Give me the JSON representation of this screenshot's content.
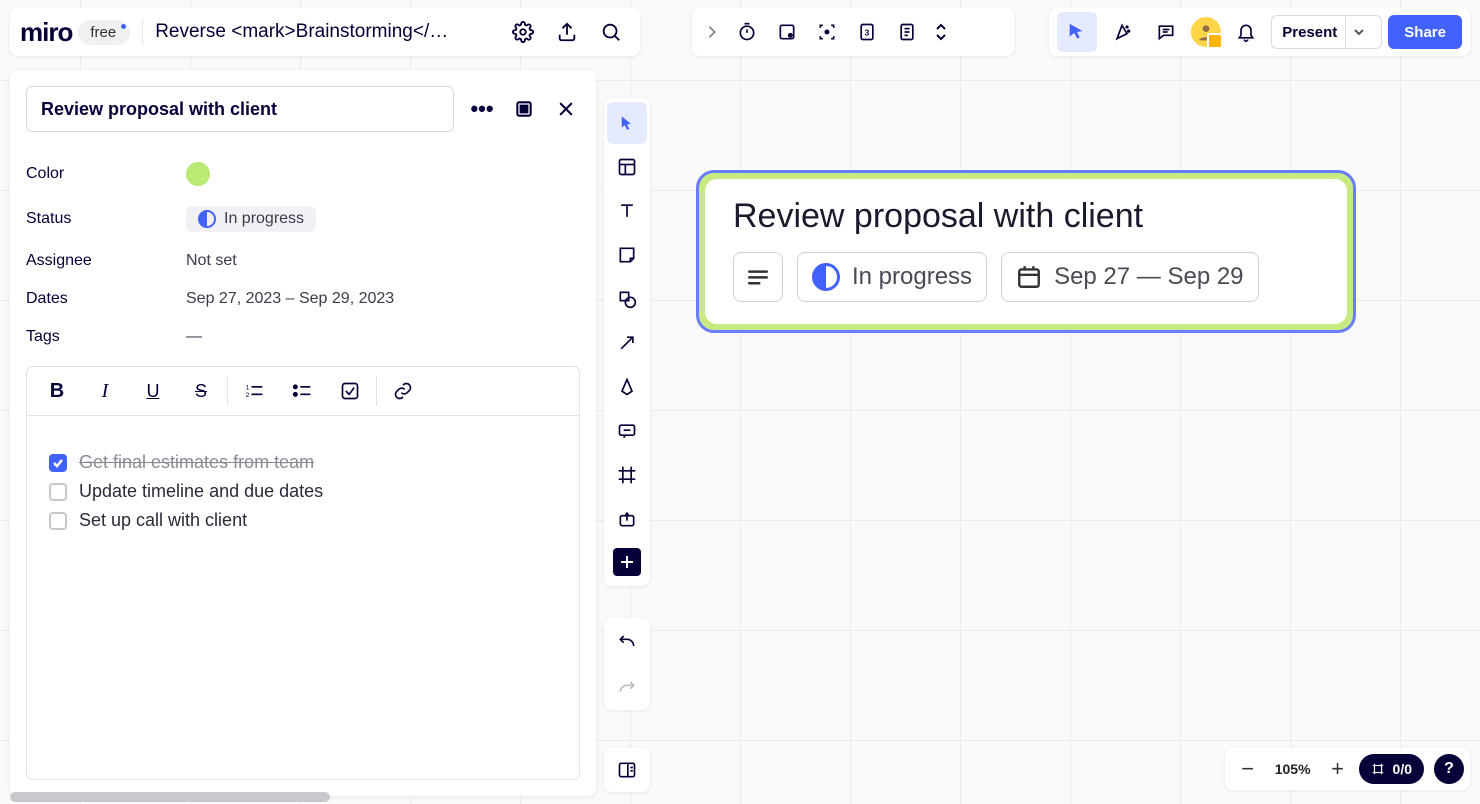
{
  "header": {
    "logo": "miro",
    "plan": "free",
    "board_title": "Reverse <mark>Brainstorming</ma..."
  },
  "topright": {
    "present": "Present",
    "share": "Share"
  },
  "panel": {
    "title": "Review proposal with client",
    "fields": {
      "color_label": "Color",
      "status_label": "Status",
      "status_value": "In progress",
      "assignee_label": "Assignee",
      "assignee_value": "Not set",
      "dates_label": "Dates",
      "dates_value": "Sep 27, 2023 – Sep 29, 2023",
      "tags_label": "Tags",
      "tags_value": "—"
    },
    "checklist": [
      {
        "text": "Get final estimates from team",
        "done": true
      },
      {
        "text": "Update timeline and due dates",
        "done": false
      },
      {
        "text": "Set up call with client",
        "done": false
      }
    ]
  },
  "card": {
    "title": "Review proposal with client",
    "status": "In progress",
    "dates": "Sep 27 — Sep 29"
  },
  "footer": {
    "zoom": "105%",
    "counter": "0/0",
    "help": "?"
  }
}
